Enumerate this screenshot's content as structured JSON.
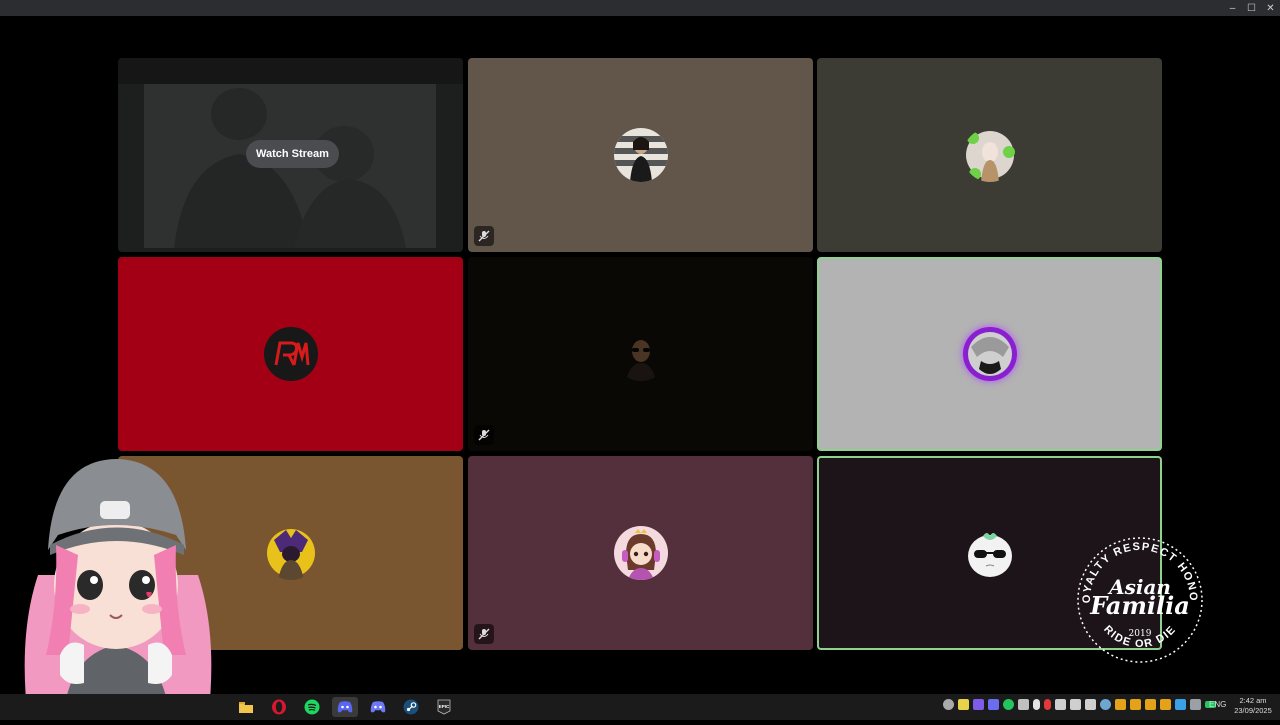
{
  "window": {
    "minimize_glyph": "–",
    "maximize_glyph": "☐",
    "close_glyph": "✕"
  },
  "stream_tile": {
    "watch_label": "Watch Stream"
  },
  "tiles": [
    {
      "id": "stream",
      "bg": "#1d1e1e",
      "muted": false,
      "speaking": false
    },
    {
      "id": "user-2",
      "bg": "#615649",
      "muted": true,
      "speaking": false,
      "avatar": "woman-striped-photo"
    },
    {
      "id": "user-3",
      "bg": "#3d3c34",
      "muted": false,
      "speaking": false,
      "avatar": "clover-anime-icon"
    },
    {
      "id": "user-4",
      "bg": "#a30015",
      "muted": false,
      "speaking": false,
      "avatar": "rm-logo-icon"
    },
    {
      "id": "user-5",
      "bg": "#0a0805",
      "muted": true,
      "speaking": false,
      "avatar": "sunglasses-man-photo"
    },
    {
      "id": "user-6",
      "bg": "#b3b3b3",
      "muted": false,
      "speaking": true,
      "avatar": "purple-glow-anime-icon"
    },
    {
      "id": "user-7",
      "bg": "#7a5630",
      "muted": false,
      "speaking": false,
      "avatar": "masked-character-icon"
    },
    {
      "id": "user-8",
      "bg": "#53303b",
      "muted": true,
      "speaking": false,
      "avatar": "girl-headphones-icon"
    },
    {
      "id": "user-9",
      "bg": "#1c1418",
      "muted": false,
      "speaking": true,
      "avatar": "bunny-sunglasses-icon"
    }
  ],
  "logo": {
    "top_text": "LOYALTY RESPECT HONOR",
    "script_line1": "Asian",
    "script_line2": "Familia",
    "year": "2019",
    "bottom_text": "RIDE OR DIE"
  },
  "taskbar": {
    "apps": [
      "file-explorer-icon",
      "opera-icon",
      "spotify-icon",
      "discord-icon",
      "discord-alt-icon",
      "steam-icon",
      "epic-games-icon"
    ],
    "active_app": "discord-icon",
    "epic_label": "EPIC",
    "lang": "ENG",
    "time": "2:42 am",
    "date": "23/09/2025"
  },
  "colors": {
    "speaking_border": "#8fd18f",
    "titlebar": "#2b2d31",
    "taskbar": "#1b1b1b"
  }
}
